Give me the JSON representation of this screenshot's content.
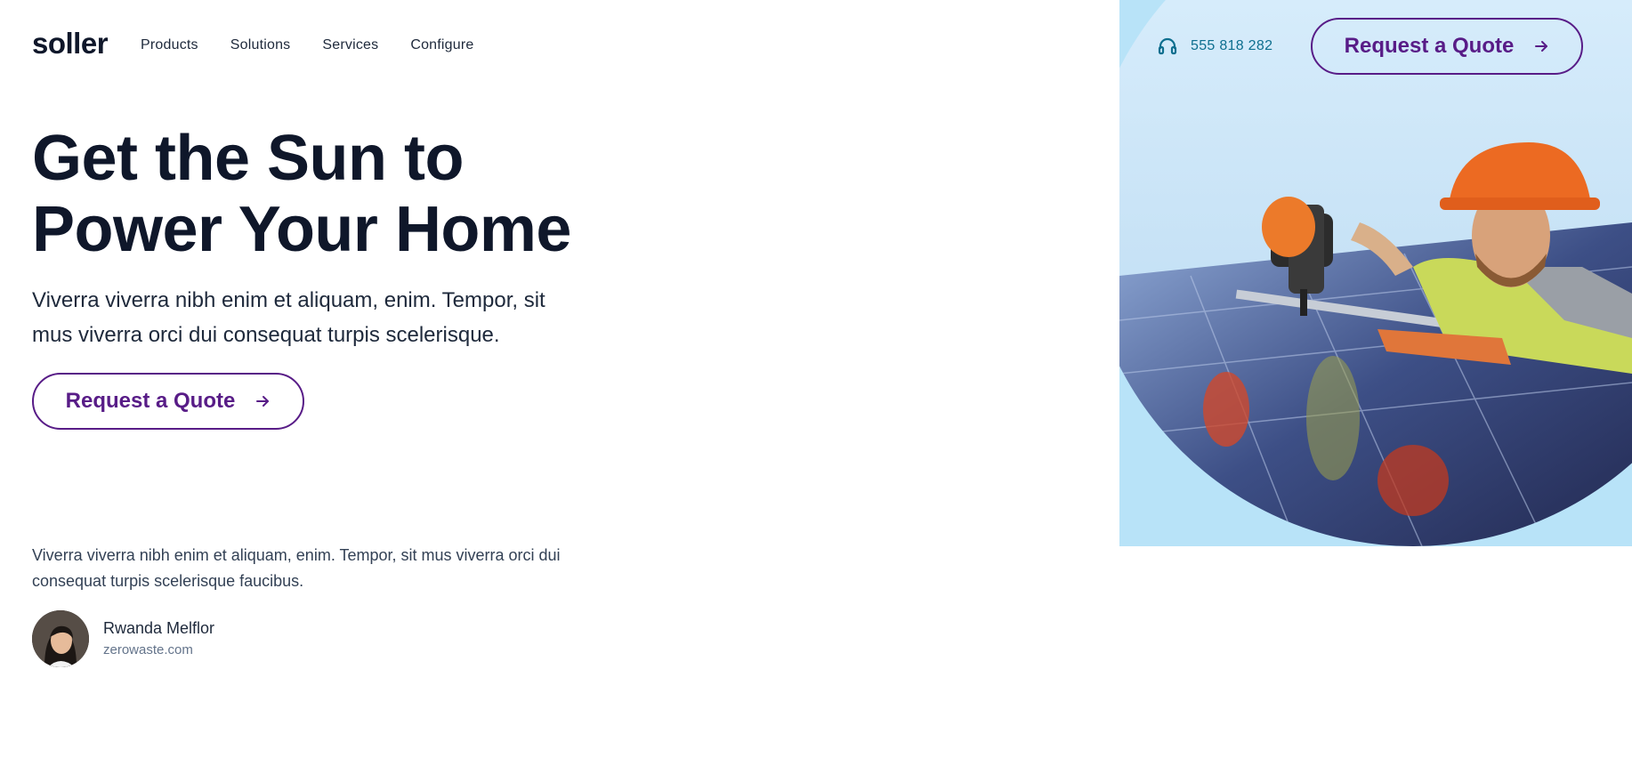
{
  "header": {
    "logo": "soller",
    "nav": [
      "Products",
      "Solutions",
      "Services",
      "Configure"
    ],
    "phone": "555 818 282",
    "cta_label": "Request a Quote"
  },
  "hero": {
    "headline_line1": "Get the Sun to",
    "headline_line2": "Power Your Home",
    "subtext": "Viverra viverra nibh enim et aliquam, enim. Tempor, sit mus viverra orci dui consequat turpis scelerisque.",
    "cta_label": "Request a Quote",
    "image_alt_icon": "solar-installer-image"
  },
  "testimonial": {
    "quote": "Viverra viverra nibh enim et aliquam, enim. Tempor, sit mus viverra orci dui consequat turpis scelerisque faucibus.",
    "author_name": "Rwanda Melflor",
    "author_site": "zerowaste.com"
  },
  "colors": {
    "brand_purple": "#581c87",
    "panel_blue": "#b8e3f8",
    "phone_teal": "#0e6f8f",
    "text_dark": "#0f172a"
  }
}
